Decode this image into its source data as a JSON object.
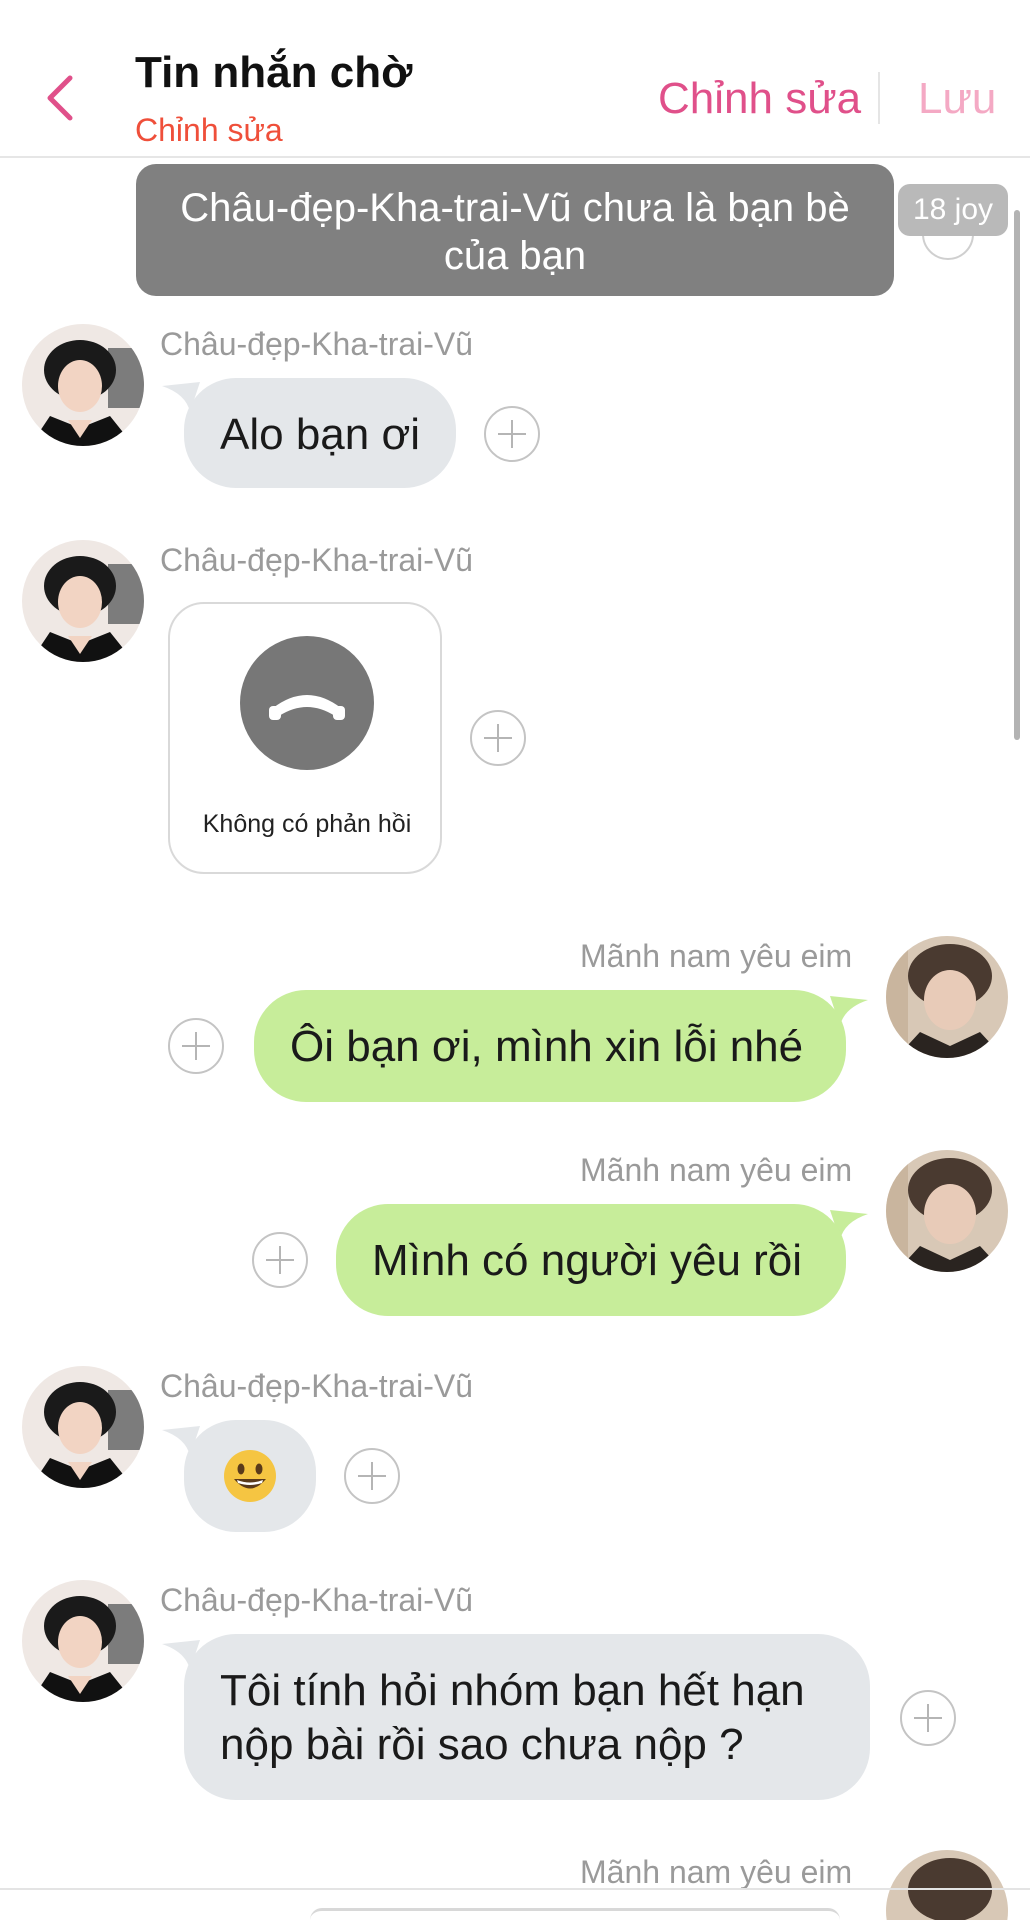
{
  "header": {
    "title": "Tin nhắn chờ",
    "subtitle": "Chỉnh sửa",
    "edit_label": "Chỉnh sửa",
    "save_label": "Lưu",
    "accent_color": "#e0508a"
  },
  "system_notice": {
    "line1": "Châu-đẹp-Kha-trai-Vũ chưa là bạn bè",
    "line2": "của bạn",
    "badge": "18 joy"
  },
  "messages": [
    {
      "sender": "Châu-đẹp-Kha-trai-Vũ",
      "type": "text",
      "side": "incoming",
      "text": "Alo bạn ơi"
    },
    {
      "sender": "Châu-đẹp-Kha-trai-Vũ",
      "type": "call",
      "side": "incoming",
      "call_status": "Không có phản hồi"
    },
    {
      "sender": "Mãnh nam yêu eim",
      "type": "text",
      "side": "outgoing",
      "text": "Ôi bạn ơi, mình xin lỗi nhé"
    },
    {
      "sender": "Mãnh nam yêu eim",
      "type": "text",
      "side": "outgoing",
      "text": "Mình có người yêu rồi"
    },
    {
      "sender": "Châu-đẹp-Kha-trai-Vũ",
      "type": "emoji",
      "side": "incoming",
      "text": "😀"
    },
    {
      "sender": "Châu-đẹp-Kha-trai-Vũ",
      "type": "text",
      "side": "incoming",
      "lines": [
        "Tôi tính hỏi nhóm bạn hết hạn",
        "nộp bài rồi sao chưa nộp ?"
      ]
    },
    {
      "sender": "Mãnh nam yêu eim",
      "type": "partial",
      "side": "outgoing"
    }
  ],
  "colors": {
    "incoming_bubble": "#e4e7ea",
    "outgoing_bubble": "#c7ed9a",
    "notice_bg": "#808080"
  }
}
